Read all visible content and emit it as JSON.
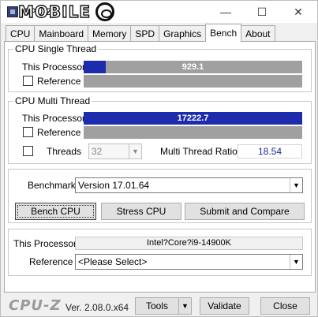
{
  "window": {
    "title": "CPU-Z",
    "watermark": "MOBILE",
    "min_glyph": "—",
    "max_glyph": "☐",
    "close_glyph": "✕"
  },
  "tabs": [
    {
      "label": "CPU"
    },
    {
      "label": "Mainboard"
    },
    {
      "label": "Memory"
    },
    {
      "label": "SPD"
    },
    {
      "label": "Graphics"
    },
    {
      "label": "Bench",
      "active": true
    },
    {
      "label": "About"
    }
  ],
  "single_thread": {
    "title": "CPU Single Thread",
    "this_label": "This Processor",
    "this_value": "929.1",
    "this_fill_fraction": 0.1,
    "reference_label": "Reference"
  },
  "multi_thread": {
    "title": "CPU Multi Thread",
    "this_label": "This Processor",
    "this_value": "17222.7",
    "this_fill_fraction": 1.0,
    "reference_label": "Reference",
    "threads_label": "Threads",
    "threads_value": "32",
    "ratio_label": "Multi Thread Ratio",
    "ratio_value": "18.54"
  },
  "benchmark": {
    "label": "Benchmark",
    "version": "Version 17.01.64",
    "bench_cpu": "Bench CPU",
    "stress_cpu": "Stress CPU",
    "submit": "Submit and Compare"
  },
  "processor": {
    "this_label": "This Processor",
    "this_value": "Intel?Core?i9-14900K",
    "reference_label": "Reference",
    "reference_value": "<Please Select>"
  },
  "footer": {
    "brand": "CPU-Z",
    "version": "Ver. 2.08.0.x64",
    "tools": "Tools",
    "validate": "Validate",
    "close": "Close"
  },
  "colors": {
    "bar_fill": "#1d2bad",
    "bar_track": "#a0a0a0",
    "ratio_text": "#1c2b8f"
  }
}
